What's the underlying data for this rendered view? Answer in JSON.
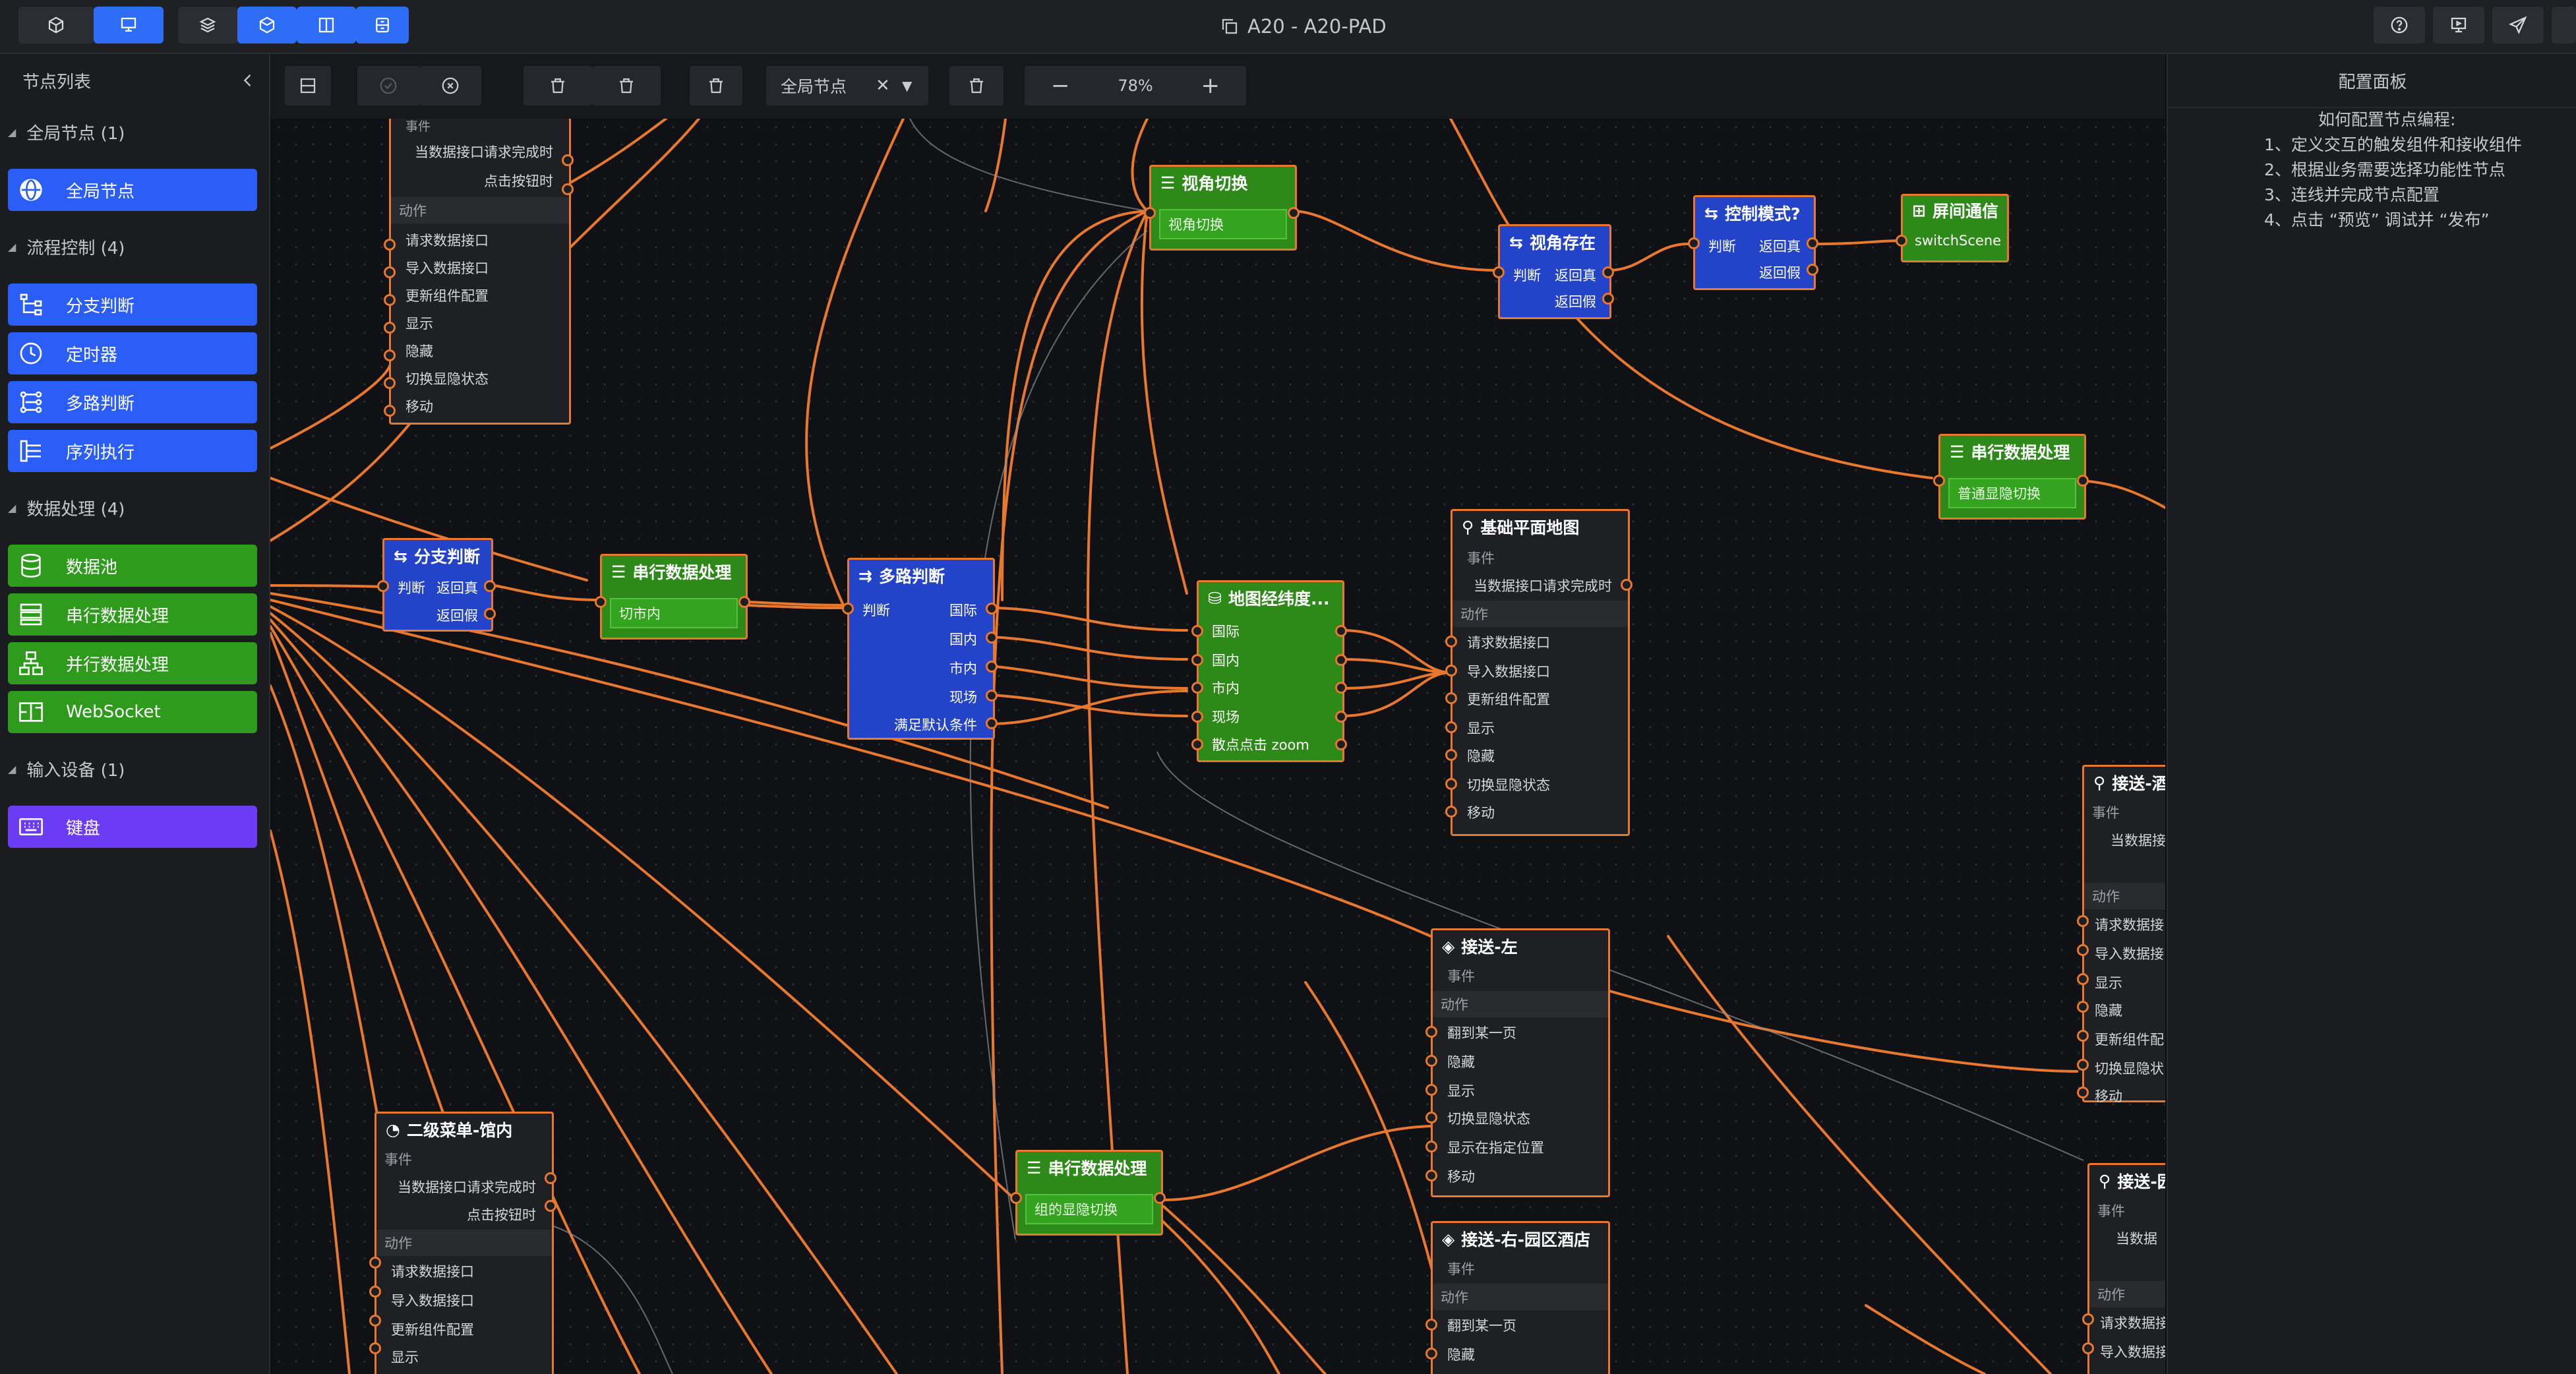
{
  "app": {
    "title": "A20 - A20-PAD"
  },
  "colors": {
    "accent_blue": "#2a5ef6",
    "flow_green": "#2f9b1d",
    "input_purple": "#6c3cf4",
    "wire_orange": "#e8782e"
  },
  "topbar": {
    "left_icons": [
      "cube-icon",
      "monitor-edit-icon",
      "layers-icon",
      "cube-outline-icon",
      "split-panel-icon",
      "archive-icon"
    ],
    "right_icons": [
      "help-icon",
      "preview-icon",
      "publish-icon"
    ]
  },
  "left_panel": {
    "title": "节点列表",
    "groups": [
      {
        "label": "全局节点 (1)",
        "items": [
          {
            "label": "全局节点",
            "icon": "globe-icon"
          }
        ]
      },
      {
        "label": "流程控制 (4)",
        "items": [
          {
            "label": "分支判断",
            "icon": "branch-icon"
          },
          {
            "label": "定时器",
            "icon": "clock-icon"
          },
          {
            "label": "多路判断",
            "icon": "multi-branch-icon"
          },
          {
            "label": "序列执行",
            "icon": "sequence-icon"
          }
        ]
      },
      {
        "label": "数据处理 (4)",
        "items": [
          {
            "label": "数据池",
            "icon": "database-icon"
          },
          {
            "label": "串行数据处理",
            "icon": "serial-data-icon"
          },
          {
            "label": "并行数据处理",
            "icon": "parallel-data-icon"
          },
          {
            "label": "WebSocket",
            "icon": "websocket-icon"
          }
        ]
      },
      {
        "label": "输入设备 (1)",
        "items": [
          {
            "label": "键盘",
            "icon": "keyboard-icon"
          }
        ]
      }
    ]
  },
  "toolbar": {
    "scope_select": "全局节点",
    "zoom": "78%"
  },
  "right_panel": {
    "title": "配置面板",
    "help_title": "如何配置节点编程:",
    "steps": [
      "1、定义交互的触发组件和接收组件",
      "2、根据业务需要选择功能性节点",
      "3、连线并完成节点配置",
      "4、点击 “预览” 调试并 “发布”"
    ]
  },
  "nodes": {
    "top_dark": {
      "events": "事件",
      "ev1": "当数据接口请求完成时",
      "ev2": "点击按钮时",
      "actions": "动作",
      "a1": "请求数据接口",
      "a2": "导入数据接口",
      "a3": "更新组件配置",
      "a4": "显示",
      "a5": "隐藏",
      "a6": "切换显隐状态",
      "a7": "移动"
    },
    "view_switch": {
      "title": "视角切换",
      "inner": "视角切换"
    },
    "view_exists": {
      "title": "视角存在",
      "judge": "判断",
      "true": "返回真",
      "false": "返回假"
    },
    "control_mode": {
      "title": "控制模式?",
      "judge": "判断",
      "true": "返回真",
      "false": "返回假"
    },
    "scene_comm": {
      "title": "屏间通信",
      "inner": "switchScene"
    },
    "serial_right": {
      "title": "串行数据处理",
      "inner": "普通显隐切换"
    },
    "branch": {
      "title": "分支判断",
      "judge": "判断",
      "true": "返回真",
      "false": "返回假"
    },
    "serial_mid": {
      "title": "串行数据处理",
      "inner": "切市内"
    },
    "multi": {
      "title": "多路判断",
      "judge": "判断",
      "o1": "国际",
      "o2": "国内",
      "o3": "市内",
      "o4": "现场",
      "o5": "满足默认条件"
    },
    "geo": {
      "title": "地图经纬度...",
      "r1": "国际",
      "r2": "国内",
      "r3": "市内",
      "r4": "现场",
      "r5": "散点点击 zoom"
    },
    "basemap": {
      "title": "基础平面地图",
      "events": "事件",
      "ev1": "当数据接口请求完成时",
      "actions": "动作",
      "a1": "请求数据接口",
      "a2": "导入数据接口",
      "a3": "更新组件配置",
      "a4": "显示",
      "a5": "隐藏",
      "a6": "切换显隐状态",
      "a7": "移动"
    },
    "pickup_left": {
      "title": "接送-左",
      "events": "事件",
      "actions": "动作",
      "a1": "翻到某一页",
      "a2": "隐藏",
      "a3": "显示",
      "a4": "切换显隐状态",
      "a5": "显示在指定位置",
      "a6": "移动"
    },
    "pickup_right": {
      "title": "接送-右-园区酒店",
      "events": "事件",
      "actions": "动作",
      "a1": "翻到某一页",
      "a2": "隐藏"
    },
    "pickup_edge1": {
      "title": "接送-酒",
      "events": "事件",
      "ev1": "当数据接",
      "actions": "动作",
      "a1": "请求数据接口",
      "a2": "导入数据接",
      "a3": "显示",
      "a4": "隐藏",
      "a5": "更新组件配",
      "a6": "切换显隐状",
      "a7": "移动"
    },
    "pickup_edge2": {
      "title": "接送-园",
      "events": "事件",
      "ev1": "当数据",
      "actions": "动作",
      "a1": "请求数据接",
      "a2": "导入数据接"
    },
    "submenu": {
      "title": "二级菜单-馆内",
      "events": "事件",
      "ev1": "当数据接口请求完成时",
      "ev2": "点击按钮时",
      "actions": "动作",
      "a1": "请求数据接口",
      "a2": "导入数据接口",
      "a3": "更新组件配置",
      "a4": "显示"
    },
    "serial_bottom": {
      "title": "串行数据处理",
      "inner": "组的显隐切换"
    }
  }
}
